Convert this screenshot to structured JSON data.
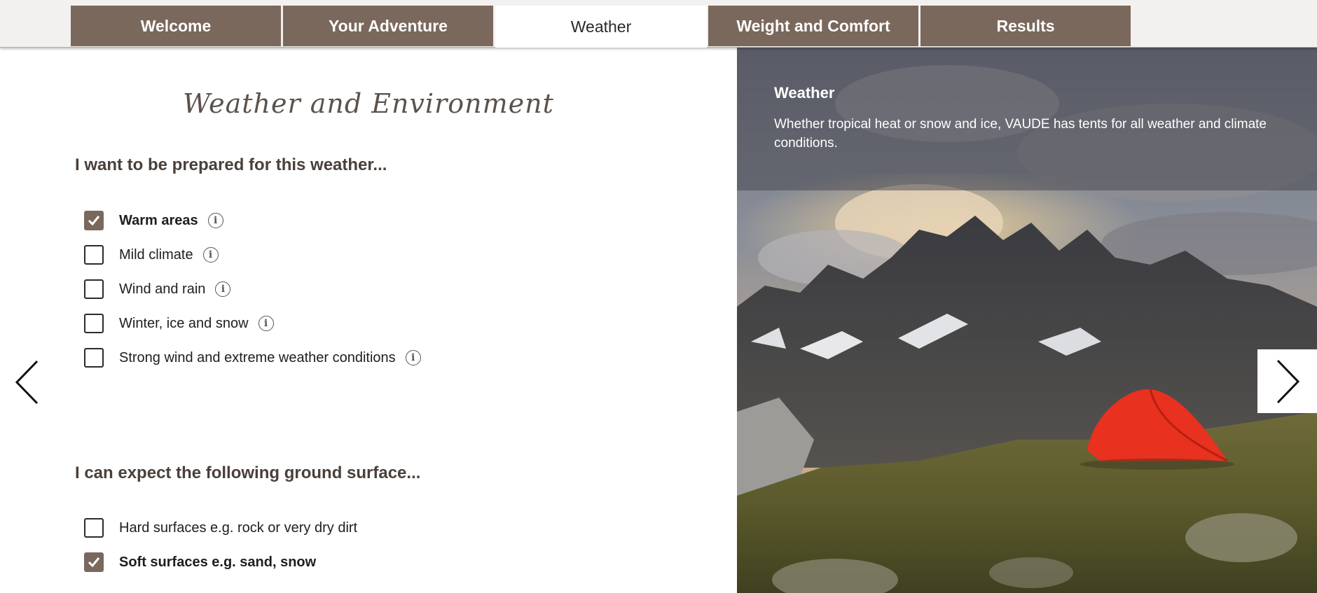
{
  "tabs": [
    {
      "label": "Welcome",
      "active": false
    },
    {
      "label": "Your Adventure",
      "active": false
    },
    {
      "label": "Weather",
      "active": true
    },
    {
      "label": "Weight and Comfort",
      "active": false
    },
    {
      "label": "Results",
      "active": false
    }
  ],
  "section_title": "Weather and Environment",
  "weather": {
    "question": "I want to be prepared for this weather...",
    "options": [
      {
        "label": "Warm areas",
        "checked": true
      },
      {
        "label": "Mild climate",
        "checked": false
      },
      {
        "label": "Wind and rain",
        "checked": false
      },
      {
        "label": "Winter, ice and snow",
        "checked": false
      },
      {
        "label": "Strong wind and extreme weather conditions",
        "checked": false
      }
    ]
  },
  "ground": {
    "question": "I can expect the following ground surface...",
    "options": [
      {
        "label": "Hard surfaces e.g. rock or very dry dirt",
        "checked": false
      },
      {
        "label": "Soft surfaces e.g. sand, snow",
        "checked": true
      }
    ]
  },
  "info_panel": {
    "title": "Weather",
    "text": "Whether tropical heat or snow and ice, VAUDE has tents for all weather and climate conditions."
  },
  "icons": {
    "info": "info-icon",
    "check": "checkmark-icon",
    "prev": "chevron-left-icon",
    "next": "chevron-right-icon"
  },
  "colors": {
    "accent": "#7a685c",
    "tent": "#e8311f"
  }
}
